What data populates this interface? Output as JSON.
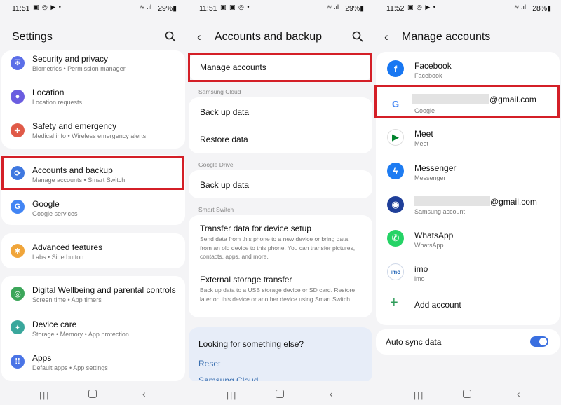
{
  "screen1": {
    "status": {
      "time": "11:51",
      "icons": "▣ ◎ ▶ •",
      "signal": "≋ .ıl",
      "battery": "29%▮"
    },
    "title": "Settings",
    "items": [
      {
        "title": "Security and privacy",
        "subtitle": "Biometrics  •  Permission manager",
        "color": "#5b6ee8",
        "icon": "shield-icon"
      },
      {
        "title": "Location",
        "subtitle": "Location requests",
        "color": "#6b5de0",
        "icon": "location-pin-icon"
      },
      {
        "title": "Safety and emergency",
        "subtitle": "Medical info  •  Wireless emergency alerts",
        "color": "#e05a48",
        "icon": "emergency-icon"
      },
      {
        "title": "Accounts and backup",
        "subtitle": "Manage accounts  •  Smart Switch",
        "color": "#3f78e0",
        "icon": "sync-icon"
      },
      {
        "title": "Google",
        "subtitle": "Google services",
        "color": "#4285f4",
        "icon": "google-icon"
      },
      {
        "title": "Advanced features",
        "subtitle": "Labs  •  Side button",
        "color": "#f0a53a",
        "icon": "star-icon"
      },
      {
        "title": "Digital Wellbeing and parental controls",
        "subtitle": "Screen time  •  App timers",
        "color": "#3ca65a",
        "icon": "wellbeing-icon"
      },
      {
        "title": "Device care",
        "subtitle": "Storage  •  Memory  •  App protection",
        "color": "#3aa79c",
        "icon": "device-care-icon"
      },
      {
        "title": "Apps",
        "subtitle": "Default apps  •  App settings",
        "color": "#4a74e6",
        "icon": "apps-icon"
      }
    ]
  },
  "screen2": {
    "status": {
      "time": "11:51",
      "icons": "▣ ▣ ◎ •",
      "signal": "≋ .ıl",
      "battery": "29%▮"
    },
    "title": "Accounts and backup",
    "manage": "Manage accounts",
    "samsung_cloud": "Samsung Cloud",
    "back_up_data": "Back up data",
    "restore_data": "Restore data",
    "google_drive": "Google Drive",
    "back_up_data_2": "Back up data",
    "smart_switch": "Smart Switch",
    "transfer_title": "Transfer data for device setup",
    "transfer_desc": "Send data from this phone to a new device or bring data from an old device to this phone. You can transfer pictures, contacts, apps, and more.",
    "external_title": "External storage transfer",
    "external_desc": "Back up data to a USB storage device or SD card. Restore later on this device or another device using Smart Switch.",
    "looking": "Looking for something else?",
    "reset": "Reset",
    "samsung_cloud_link": "Samsung Cloud"
  },
  "screen3": {
    "status": {
      "time": "11:52",
      "icons": "▣ ◎ ▶ •",
      "signal": "≋ .ıl",
      "battery": "28%▮"
    },
    "title": "Manage accounts",
    "accounts": [
      {
        "title": "Facebook",
        "subtitle": "Facebook",
        "color": "#1877f2",
        "glyph": "f"
      },
      {
        "title": "@gmail.com",
        "subtitle": "Google",
        "color": "#ffffff",
        "glyph": "G"
      },
      {
        "title": "Meet",
        "subtitle": "Meet",
        "color": "#ffffff",
        "glyph": "▶"
      },
      {
        "title": "Messenger",
        "subtitle": "Messenger",
        "color": "#1e7cf2",
        "glyph": "ϟ"
      },
      {
        "title": "@gmail.com",
        "subtitle": "Samsung account",
        "color": "#1f3f99",
        "glyph": "◉"
      },
      {
        "title": "WhatsApp",
        "subtitle": "WhatsApp",
        "color": "#25d366",
        "glyph": "✆"
      },
      {
        "title": "imo",
        "subtitle": "imo",
        "color": "#ffffff",
        "glyph": "imo"
      }
    ],
    "add_account": "Add account",
    "auto_sync": "Auto sync data"
  },
  "colors": {
    "highlight": "#d41f27",
    "accent": "#3a6fe0",
    "link": "#3a6fb0"
  }
}
